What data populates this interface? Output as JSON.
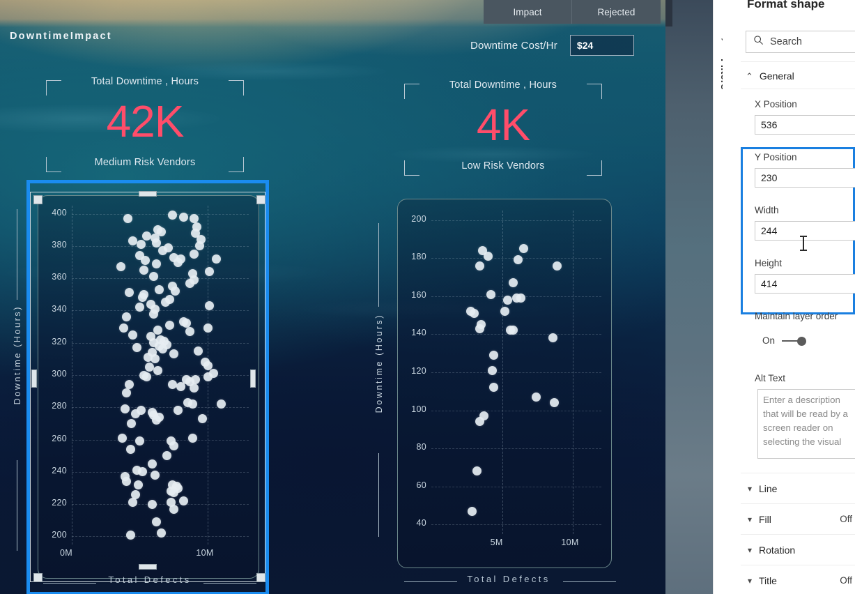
{
  "report": {
    "title": "DowntimeImpact",
    "tabs": [
      {
        "label": "Impact",
        "active": true
      },
      {
        "label": "Rejected",
        "active": false
      }
    ],
    "cost_field": {
      "label": "Downtime Cost/Hr",
      "value": "$24"
    },
    "kpis": [
      {
        "top_label": "Total Downtime , Hours",
        "value": "42K",
        "bottom_label": "Medium Risk Vendors",
        "color": "#ff4d6a"
      },
      {
        "top_label": "Total Downtime , Hours",
        "value": "4K",
        "bottom_label": "Low Risk Vendors",
        "color": "#ff4d6a"
      }
    ]
  },
  "chart_data": [
    {
      "type": "scatter",
      "title": "",
      "xlabel": "Total Defects",
      "ylabel": "Downtime (Hours)",
      "xlim": [
        0,
        13000000
      ],
      "ylim": [
        195,
        405
      ],
      "xticks": [
        "0M",
        "10M"
      ],
      "xtick_values": [
        0,
        10000000
      ],
      "yticks": [
        "200",
        "220",
        "240",
        "260",
        "280",
        "300",
        "320",
        "340",
        "360",
        "380",
        "400"
      ],
      "ytick_values": [
        200,
        220,
        240,
        260,
        280,
        300,
        320,
        340,
        360,
        380,
        400
      ],
      "grid": true,
      "marker_color": "#e7eef3",
      "points": [
        [
          4100000,
          397
        ],
        [
          7400000,
          399
        ],
        [
          8200000,
          398
        ],
        [
          9000000,
          397
        ],
        [
          9200000,
          392
        ],
        [
          6300000,
          390
        ],
        [
          6600000,
          389
        ],
        [
          9100000,
          388
        ],
        [
          5500000,
          386
        ],
        [
          6100000,
          385
        ],
        [
          9500000,
          384
        ],
        [
          4500000,
          383
        ],
        [
          6200000,
          382
        ],
        [
          5100000,
          381
        ],
        [
          9400000,
          380
        ],
        [
          7100000,
          379
        ],
        [
          6700000,
          377
        ],
        [
          9000000,
          375
        ],
        [
          5000000,
          374
        ],
        [
          7500000,
          373
        ],
        [
          8000000,
          372
        ],
        [
          5400000,
          371
        ],
        [
          10600000,
          372
        ],
        [
          7800000,
          370
        ],
        [
          6200000,
          369
        ],
        [
          3600000,
          367
        ],
        [
          5300000,
          365
        ],
        [
          10100000,
          364
        ],
        [
          8900000,
          363
        ],
        [
          6000000,
          361
        ],
        [
          9000000,
          359
        ],
        [
          8700000,
          357
        ],
        [
          7400000,
          355
        ],
        [
          6400000,
          353
        ],
        [
          4200000,
          351
        ],
        [
          5300000,
          350
        ],
        [
          7600000,
          352
        ],
        [
          5200000,
          348
        ],
        [
          7200000,
          347
        ],
        [
          5800000,
          344
        ],
        [
          6900000,
          345
        ],
        [
          10100000,
          343
        ],
        [
          5000000,
          342
        ],
        [
          6100000,
          341
        ],
        [
          6000000,
          338
        ],
        [
          4000000,
          336
        ],
        [
          8200000,
          333
        ],
        [
          8400000,
          332
        ],
        [
          7200000,
          331
        ],
        [
          3800000,
          329
        ],
        [
          10000000,
          329
        ],
        [
          8700000,
          327
        ],
        [
          6300000,
          328
        ],
        [
          4500000,
          325
        ],
        [
          5800000,
          324
        ],
        [
          6500000,
          322
        ],
        [
          6800000,
          321
        ],
        [
          6000000,
          320
        ],
        [
          7000000,
          319
        ],
        [
          4800000,
          317
        ],
        [
          6400000,
          318
        ],
        [
          6700000,
          316
        ],
        [
          9300000,
          315
        ],
        [
          5900000,
          314
        ],
        [
          7500000,
          313
        ],
        [
          5600000,
          311
        ],
        [
          6100000,
          310
        ],
        [
          9800000,
          308
        ],
        [
          10000000,
          306
        ],
        [
          5700000,
          305
        ],
        [
          6300000,
          303
        ],
        [
          5300000,
          300
        ],
        [
          5500000,
          299
        ],
        [
          10400000,
          301
        ],
        [
          10000000,
          299
        ],
        [
          8400000,
          297
        ],
        [
          8700000,
          296
        ],
        [
          9100000,
          297
        ],
        [
          4200000,
          294
        ],
        [
          7400000,
          294
        ],
        [
          8000000,
          293
        ],
        [
          9000000,
          292
        ],
        [
          4000000,
          289
        ],
        [
          8500000,
          283
        ],
        [
          8900000,
          282
        ],
        [
          11000000,
          282
        ],
        [
          3900000,
          279
        ],
        [
          7800000,
          278
        ],
        [
          5100000,
          278
        ],
        [
          5900000,
          277
        ],
        [
          4700000,
          276
        ],
        [
          6000000,
          275
        ],
        [
          6400000,
          274
        ],
        [
          6200000,
          272
        ],
        [
          9600000,
          273
        ],
        [
          4400000,
          270
        ],
        [
          3700000,
          261
        ],
        [
          8900000,
          261
        ],
        [
          5000000,
          259
        ],
        [
          7300000,
          259
        ],
        [
          7500000,
          256
        ],
        [
          4300000,
          254
        ],
        [
          7000000,
          250
        ],
        [
          5900000,
          245
        ],
        [
          4800000,
          241
        ],
        [
          5200000,
          240
        ],
        [
          6100000,
          238
        ],
        [
          3900000,
          237
        ],
        [
          4000000,
          234
        ],
        [
          4900000,
          232
        ],
        [
          7400000,
          232
        ],
        [
          7700000,
          231
        ],
        [
          7800000,
          230
        ],
        [
          7300000,
          228
        ],
        [
          7500000,
          227
        ],
        [
          4700000,
          226
        ],
        [
          4500000,
          221
        ],
        [
          5900000,
          220
        ],
        [
          7300000,
          221
        ],
        [
          8200000,
          222
        ],
        [
          7500000,
          217
        ],
        [
          6200000,
          209
        ],
        [
          4300000,
          201
        ],
        [
          6600000,
          202
        ]
      ],
      "selected": true
    },
    {
      "type": "scatter",
      "title": "",
      "xlabel": "Total Defects",
      "ylabel": "Downtime (Hours)",
      "xlim": [
        0,
        12000000
      ],
      "ylim": [
        35,
        205
      ],
      "xticks": [
        "5M",
        "10M"
      ],
      "xtick_values": [
        5000000,
        10000000
      ],
      "yticks": [
        "40",
        "60",
        "80",
        "100",
        "120",
        "140",
        "160",
        "180",
        "200"
      ],
      "ytick_values": [
        40,
        60,
        80,
        100,
        120,
        140,
        160,
        180,
        200
      ],
      "grid": true,
      "marker_color": "#e7eef3",
      "points": [
        [
          3600000,
          184
        ],
        [
          4000000,
          181
        ],
        [
          6500000,
          185
        ],
        [
          3400000,
          176
        ],
        [
          6100000,
          179
        ],
        [
          8900000,
          176
        ],
        [
          5800000,
          167
        ],
        [
          4200000,
          161
        ],
        [
          5400000,
          158
        ],
        [
          6000000,
          159
        ],
        [
          6300000,
          159
        ],
        [
          2800000,
          152
        ],
        [
          3000000,
          151
        ],
        [
          5200000,
          152
        ],
        [
          3500000,
          145
        ],
        [
          3400000,
          143
        ],
        [
          5600000,
          142
        ],
        [
          5800000,
          142
        ],
        [
          8600000,
          138
        ],
        [
          4400000,
          129
        ],
        [
          4300000,
          121
        ],
        [
          4400000,
          112
        ],
        [
          7400000,
          107
        ],
        [
          3400000,
          94
        ],
        [
          3700000,
          97
        ],
        [
          8700000,
          104
        ],
        [
          3200000,
          68
        ],
        [
          2900000,
          47
        ]
      ],
      "selected": false
    }
  ],
  "format_pane": {
    "collapse_chevron": "chevron-left",
    "filters_label": "Filters",
    "title": "Format shape",
    "search_placeholder": "Search",
    "sections": [
      {
        "label": "General",
        "expanded": true,
        "state": ""
      },
      {
        "label": "Line",
        "expanded": false,
        "state": ""
      },
      {
        "label": "Fill",
        "expanded": false,
        "state": "Off"
      },
      {
        "label": "Rotation",
        "expanded": false,
        "state": ""
      },
      {
        "label": "Title",
        "expanded": false,
        "state": "Off"
      }
    ],
    "general": {
      "x_position_label": "X Position",
      "x_position_value": "536",
      "y_position_label": "Y Position",
      "y_position_value": "230",
      "width_label": "Width",
      "width_value": "244",
      "height_label": "Height",
      "height_value": "414",
      "maintain_layer_order_label": "Maintain layer order",
      "maintain_layer_order_state": "On",
      "alt_text_label": "Alt Text",
      "alt_text_placeholder": "Enter a description that will be read by a screen reader on selecting the visual"
    }
  }
}
